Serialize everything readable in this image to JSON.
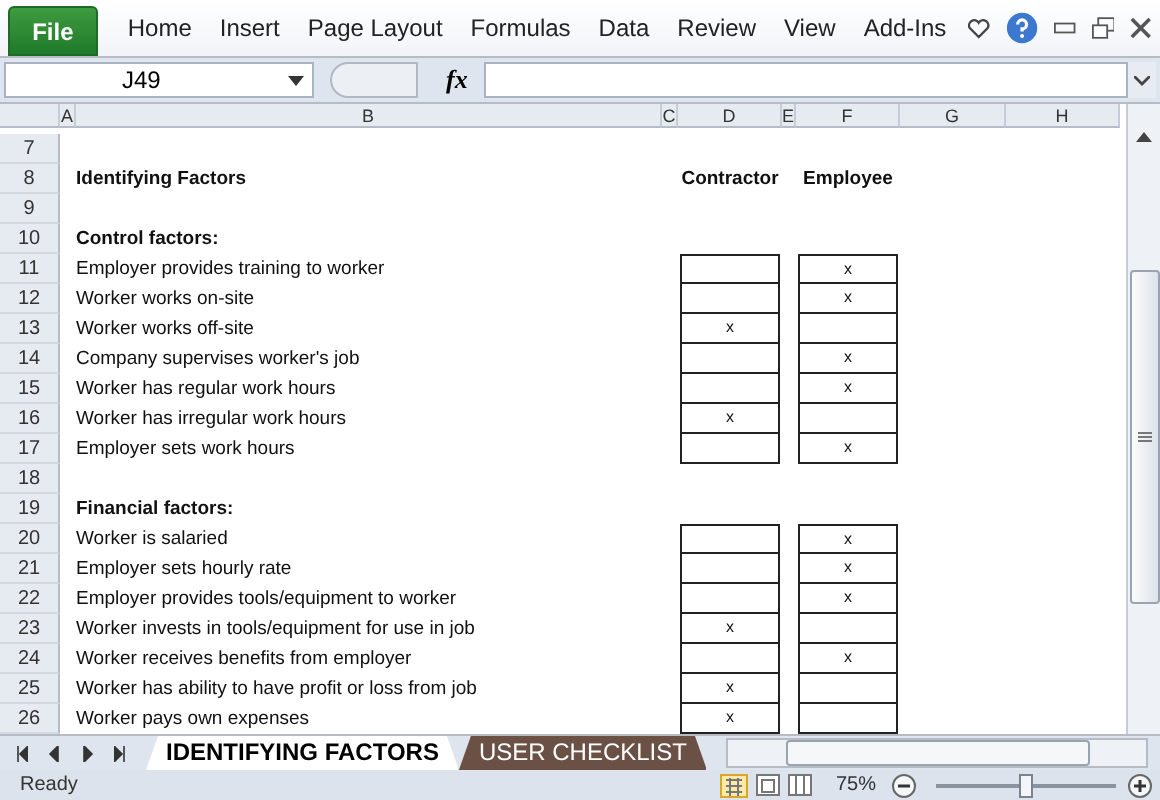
{
  "ribbon": {
    "file_tab": "File",
    "tabs": [
      "Home",
      "Insert",
      "Page Layout",
      "Formulas",
      "Data",
      "Review",
      "View",
      "Add-Ins"
    ]
  },
  "formula_bar": {
    "name_box": "J49",
    "fx": "fx"
  },
  "columns": [
    "A",
    "B",
    "C",
    "D",
    "E",
    "F",
    "G",
    "H"
  ],
  "rows": [
    {
      "number": "7",
      "kind": "blank"
    },
    {
      "number": "8",
      "kind": "header",
      "label": "Identifying Factors",
      "contractor": "Contractor",
      "employee": "Employee"
    },
    {
      "number": "9",
      "kind": "blank"
    },
    {
      "number": "10",
      "kind": "section",
      "label": "Control factors:"
    },
    {
      "number": "11",
      "kind": "item",
      "label": "Employer provides training to worker",
      "employee": "x"
    },
    {
      "number": "12",
      "kind": "item",
      "label": "Worker works on-site",
      "employee": "x"
    },
    {
      "number": "13",
      "kind": "item",
      "label": "Worker works off-site",
      "contractor": "x"
    },
    {
      "number": "14",
      "kind": "item",
      "label": "Company supervises worker's job",
      "employee": "x"
    },
    {
      "number": "15",
      "kind": "item",
      "label": "Worker has regular work hours",
      "employee": "x"
    },
    {
      "number": "16",
      "kind": "item",
      "label": "Worker has irregular work hours",
      "contractor": "x"
    },
    {
      "number": "17",
      "kind": "item",
      "label": "Employer sets work hours",
      "employee": "x"
    },
    {
      "number": "18",
      "kind": "blank"
    },
    {
      "number": "19",
      "kind": "section",
      "label": "Financial factors:"
    },
    {
      "number": "20",
      "kind": "item",
      "label": "Worker is salaried",
      "employee": "x"
    },
    {
      "number": "21",
      "kind": "item",
      "label": "Employer sets hourly rate",
      "employee": "x"
    },
    {
      "number": "22",
      "kind": "item",
      "label": "Employer provides tools/equipment to worker",
      "employee": "x"
    },
    {
      "number": "23",
      "kind": "item",
      "label": "Worker invests in tools/equipment for use in job",
      "contractor": "x"
    },
    {
      "number": "24",
      "kind": "item",
      "label": "Worker receives benefits from employer",
      "employee": "x"
    },
    {
      "number": "25",
      "kind": "item",
      "label": "Worker has ability to have profit or loss from job",
      "contractor": "x"
    },
    {
      "number": "26",
      "kind": "item",
      "label": "Worker pays own expenses",
      "contractor": "x"
    }
  ],
  "sheet_tabs": [
    {
      "label": "IDENTIFYING FACTORS",
      "selected": true
    },
    {
      "label": "USER CHECKLIST",
      "selected": false
    }
  ],
  "status_bar": {
    "status": "Ready",
    "zoom": "75%",
    "zoom_level": {
      "level": 0.5
    }
  }
}
